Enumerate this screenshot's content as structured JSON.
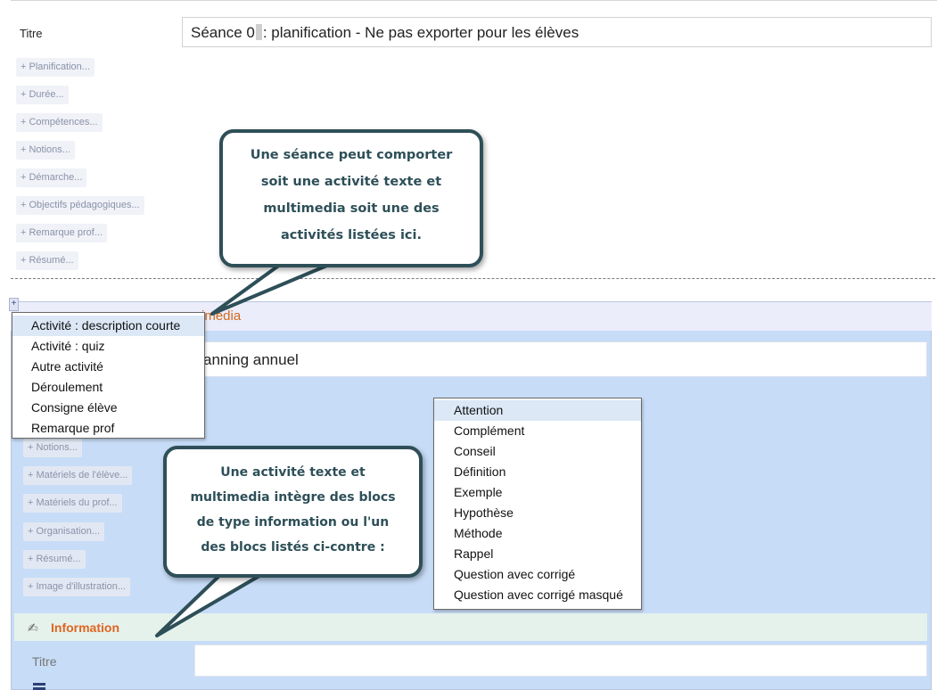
{
  "seance": {
    "title_label": "Titre",
    "title_value_before": "Séance 0",
    "title_value_after": ": planification - Ne pas exporter pour les élèves"
  },
  "seance_chips": [
    "+ Planification...",
    "+ Durée...",
    "+ Compétences...",
    "+ Notions...",
    "+ Démarche...",
    "+ Objectifs pédagogiques...",
    "+ Remarque prof...",
    "+ Résumé..."
  ],
  "add_button": "+",
  "activity": {
    "header_text": "imedia",
    "title_value": "anning annuel"
  },
  "activity_chips": [
    "+ Notions...",
    "+ Matériels de l'élève...",
    "+ Matériels du prof...",
    "+ Organisation...",
    "+ Résumé...",
    "+ Image d'illustration..."
  ],
  "activity_menu": [
    "Activité : description courte",
    "Activité : quiz",
    "Autre activité",
    "Déroulement",
    "Consigne élève",
    "Remarque prof"
  ],
  "block_menu": [
    "Attention",
    "Complément",
    "Conseil",
    "Définition",
    "Exemple",
    "Hypothèse",
    "Méthode",
    "Rappel",
    "Question avec corrigé",
    "Question avec corrigé masqué"
  ],
  "information": {
    "title": "Information",
    "field_label": "Titre",
    "field_value": ""
  },
  "callouts": {
    "top": [
      "Une séance peut comporter",
      "soit une activité texte et",
      "multimedia soit une des",
      "activités listées ici."
    ],
    "bottom": [
      "Une activité texte et",
      "multimedia intègre des blocs",
      "de type information ou l'un",
      "des blocs listés ci-contre :"
    ]
  },
  "colors": {
    "activity_panel": "#c7dcf7",
    "accent_orange": "#e0641f",
    "callout_border": "#2e4f58",
    "menu_highlight": "#dce8f6"
  }
}
